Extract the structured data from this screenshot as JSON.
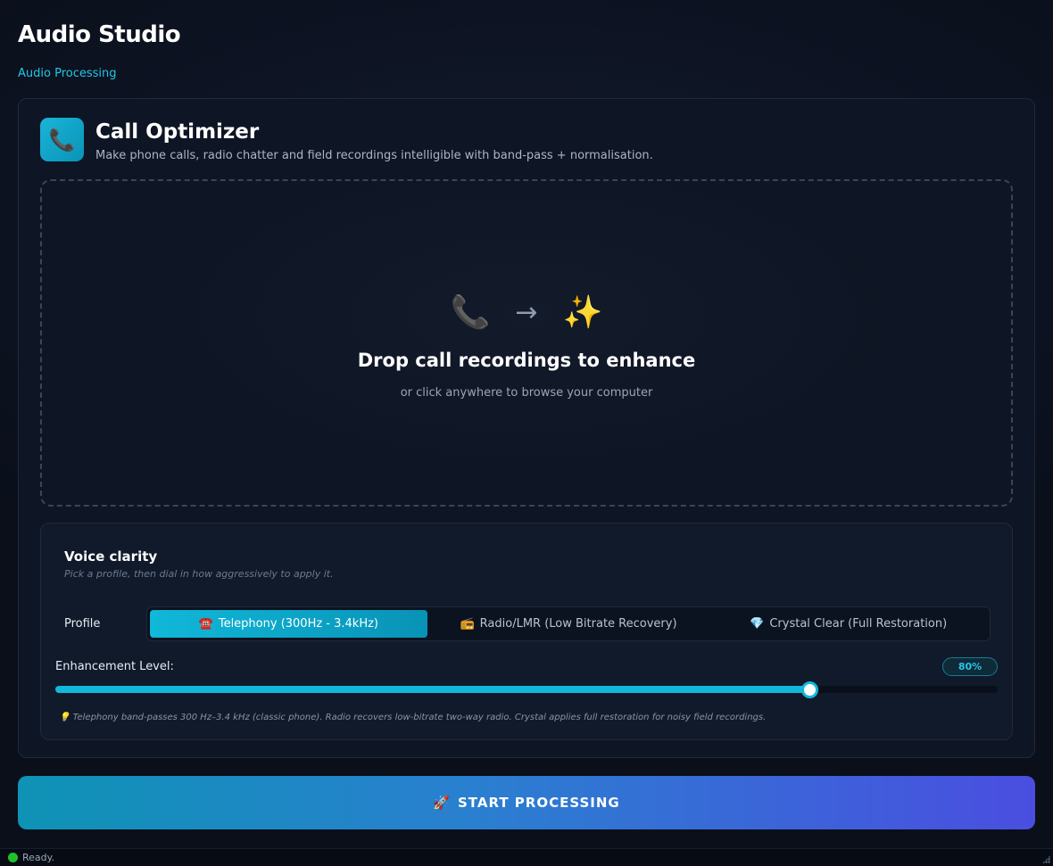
{
  "app": {
    "title": "Audio Studio",
    "subtitle": "Audio Processing"
  },
  "tool": {
    "icon": "phone-receiver-icon",
    "icon_glyph": "📞",
    "title": "Call Optimizer",
    "description": "Make phone calls, radio chatter and field recordings intelligible with band-pass + normalisation."
  },
  "dropzone": {
    "icon_left": "📞",
    "icon_arrow": "→",
    "icon_right": "✨",
    "title": "Drop call recordings to enhance",
    "hint": "or click anywhere to browse your computer"
  },
  "settings": {
    "title": "Voice clarity",
    "description": "Pick a profile, then dial in how aggressively to apply it.",
    "profile_label": "Profile",
    "profiles": [
      {
        "icon": "☎️",
        "label": "Telephony (300Hz - 3.4kHz)",
        "active": true
      },
      {
        "icon": "📻",
        "label": "Radio/LMR (Low Bitrate Recovery)",
        "active": false
      },
      {
        "icon": "💎",
        "label": "Crystal Clear (Full Restoration)",
        "active": false
      }
    ],
    "enhancement_label": "Enhancement Level:",
    "enhancement_value": 80,
    "enhancement_display": "80%",
    "tip": "💡 Telephony band-passes 300 Hz–3.4 kHz (classic phone). Radio recovers low-bitrate two-way radio. Crystal applies full restoration for noisy field recordings."
  },
  "actions": {
    "start_icon": "🚀",
    "start_label": "START PROCESSING"
  },
  "status": {
    "text": "Ready.",
    "color": "#1fc12b"
  },
  "colors": {
    "accent": "#12b8d9",
    "gradient_end": "#4a4ee0"
  }
}
